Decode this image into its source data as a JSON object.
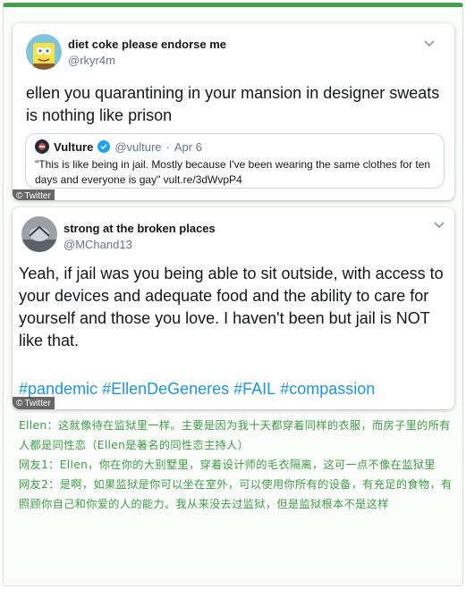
{
  "tweet1": {
    "display_name": "diet coke please endorse me",
    "handle": "@rkyr4m",
    "text": "ellen you quarantining in your mansion in designer sweats is nothing like prison",
    "quoted": {
      "name": "Vulture",
      "handle": "@vulture",
      "separator": "·",
      "date": "Apr 6",
      "text": "\"This is like being in jail. Mostly because I've been wearing the same clothes for ten days and everyone is gay\" vult.re/3dWvpP4"
    },
    "source_tag": "Twitter"
  },
  "tweet2": {
    "display_name": "strong at the broken places",
    "handle": "@MChand13",
    "text": "Yeah, if jail was you being able to sit outside, with access to your devices and adequate food and the ability to care for yourself and those you love.  I haven't been but jail is NOT like that.",
    "hashtags": [
      "#pandemic",
      "#EllenDeGeneres",
      "#FAIL",
      "#compassion"
    ],
    "source_tag": "Twitter"
  },
  "caption": [
    "Ellen：这就像待在监狱里一样。主要是因为我十天都穿着同样的衣服，而房子里的所有人都是同性恋（Ellen是著名的同性恋主持人）",
    "网友1：Ellen，你在你的大别墅里，穿着设计师的毛衣隔离，这可一点不像在监狱里",
    "网友2：是啊，如果监狱是你可以坐在室外，可以使用你所有的设备，有充足的食物，有照顾你自己和你爱的人的能力。我从来没去过监狱，但是监狱根本不是这样"
  ],
  "colors": {
    "accent_green": "#3fa34d",
    "caption_green": "#3f9b46",
    "hashtag_blue": "#1b95e0",
    "verified_blue": "#1da1f2"
  }
}
